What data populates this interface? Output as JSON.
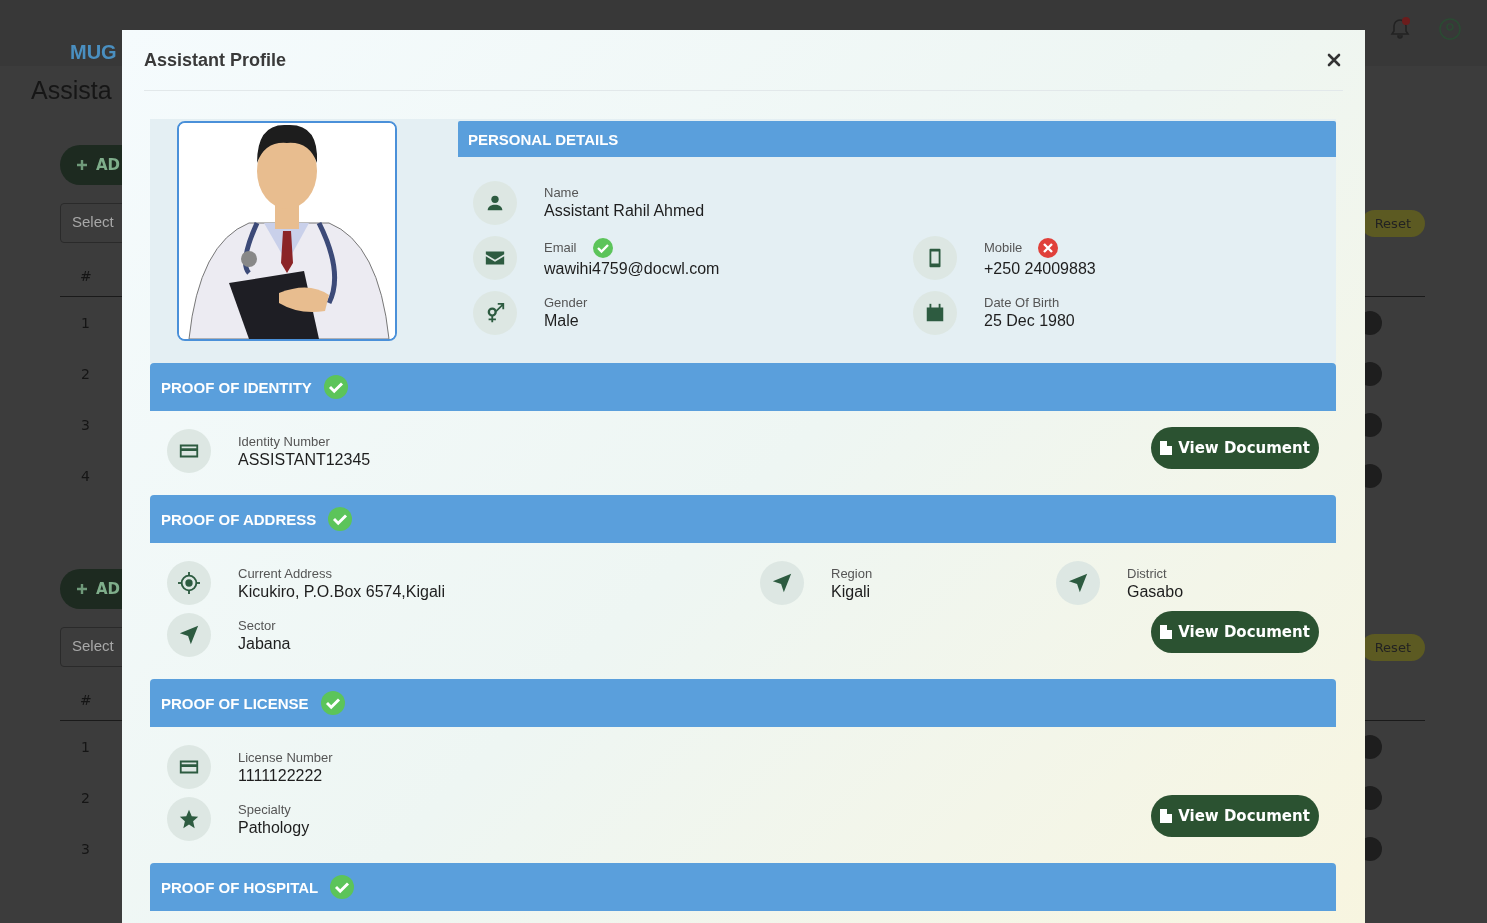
{
  "background": {
    "logo": "MUG",
    "title": "Assista",
    "sections": [
      {
        "add_button": "AD",
        "select_placeholder": "Select",
        "reset_button": "Reset",
        "column_1": "#",
        "rows": [
          "1",
          "2",
          "3",
          "4"
        ]
      },
      {
        "add_button": "AD",
        "select_placeholder": "Select",
        "reset_button": "Reset",
        "column_1": "#",
        "rows": [
          "1",
          "2",
          "3"
        ]
      }
    ]
  },
  "modal": {
    "title": "Assistant Profile",
    "personal": {
      "title": "PERSONAL DETAILS",
      "photo": {
        "kind": "picture"
      },
      "rows": [
        [
          {
            "kind": "person",
            "label": "Name",
            "value": "Assistant Rahil Ahmed"
          }
        ],
        [
          {
            "kind": "email",
            "label": "Email",
            "value": "wawihi4759@docwl.com",
            "verified": true
          },
          {
            "kind": "phone",
            "label": "Mobile",
            "value": "+250 24009883",
            "verified": false
          }
        ],
        [
          {
            "kind": "gender",
            "label": "Gender",
            "value": "Male"
          },
          {
            "kind": "calendar",
            "label": "Date Of Birth",
            "value": "25 Dec 1980"
          }
        ]
      ]
    },
    "sections": [
      {
        "title": "PROOF OF IDENTITY",
        "verified": true,
        "button": "View Document",
        "rows": [
          [
            {
              "kind": "card",
              "label": "Identity Number",
              "value": "ASSISTANT12345"
            }
          ]
        ]
      },
      {
        "title": "PROOF OF ADDRESS",
        "verified": true,
        "button": "View Document",
        "rows": [
          [
            {
              "kind": "target",
              "label": "Current Address",
              "value": "Kicukiro, P.O.Box 6574,Kigali"
            },
            {
              "kind": "location",
              "label": "Region",
              "value": "Kigali"
            },
            {
              "kind": "location",
              "label": "District",
              "value": "Gasabo"
            }
          ],
          [
            {
              "kind": "location",
              "label": "Sector",
              "value": "Jabana"
            }
          ]
        ]
      },
      {
        "title": "PROOF OF LICENSE",
        "verified": true,
        "button": "View Document",
        "rows": [
          [
            {
              "kind": "card",
              "label": "License Number",
              "value": "1111122222"
            }
          ],
          [
            {
              "kind": "star",
              "label": "Specialty",
              "value": "Pathology"
            }
          ]
        ]
      },
      {
        "title": "PROOF OF HOSPITAL",
        "verified": true
      }
    ]
  }
}
